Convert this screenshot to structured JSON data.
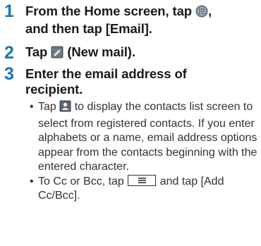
{
  "steps": [
    {
      "number": "1",
      "text_a": "From the Home screen, tap",
      "text_b": ",",
      "text_c": "and then tap [Email].",
      "icon": "app-drawer-icon"
    },
    {
      "number": "2",
      "text_a": "Tap",
      "text_b": "(New mail).",
      "icon": "new-mail-icon"
    },
    {
      "number": "3",
      "text_a": "Enter the email address of",
      "text_b": "recipient.",
      "bullets": [
        {
          "dot": "•",
          "text_a": "Tap",
          "text_b": "to display the contacts list screen to select from registered contacts. If you enter alphabets or a name, email address options appear from the contacts beginning with the entered character.",
          "icon": "contacts-icon"
        },
        {
          "dot": "•",
          "text_a": "To Cc or Bcc, tap",
          "text_b": "and tap [Add Cc/Bcc].",
          "icon": "menu-key-icon"
        }
      ]
    }
  ],
  "colors": {
    "step_number": "#1c75b0",
    "heading_text": "#1a1a1a",
    "body_text": "#333333"
  }
}
